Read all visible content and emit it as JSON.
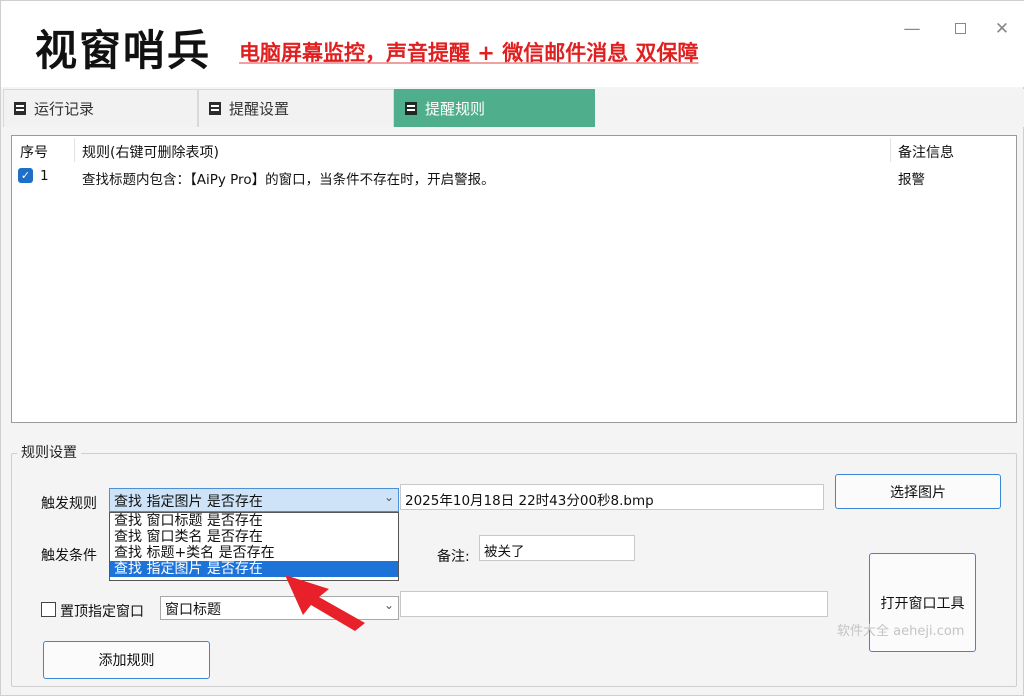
{
  "app": {
    "title": "视窗哨兵",
    "slogan": "电脑屏幕监控，声音提醒 + 微信邮件消息 双保障",
    "window_controls": {
      "minimize": "—",
      "close": "✕"
    }
  },
  "tabs": [
    {
      "label": "运行记录",
      "active": false
    },
    {
      "label": "提醒设置",
      "active": false
    },
    {
      "label": "提醒规则",
      "active": true
    }
  ],
  "rules_table": {
    "columns": [
      "序号",
      "规则(右键可删除表项)",
      "备注信息"
    ],
    "rows": [
      {
        "checked": true,
        "index": "1",
        "rule": "查找标题内包含：【AiPy Pro】的窗口，当条件不存在时，开启警报。",
        "note": "报警"
      }
    ]
  },
  "rule_settings": {
    "group_title": "规则设置",
    "trigger_rule_label": "触发规则",
    "trigger_rule_value": "查找 指定图片 是否存在",
    "trigger_rule_options": [
      "查找 窗口标题 是否存在",
      "查找 窗口类名 是否存在",
      "查找 标题+类名 是否存在",
      "查找 指定图片 是否存在"
    ],
    "selected_option_index": 3,
    "image_file": "2025年10月18日 22时43分00秒8.bmp",
    "choose_image_button": "选择图片",
    "trigger_condition_label": "触发条件",
    "note_label": "备注:",
    "note_value": "被关了",
    "pin_window_label": "置顶指定窗口",
    "pin_window_checked": false,
    "pin_window_combo": "窗口标题",
    "pin_window_text": "",
    "open_window_tool_button": "打开窗口工具",
    "add_rule_button": "添加规则"
  },
  "watermark": "软件大全 aeheji.com",
  "colors": {
    "accent": "#4fae8c",
    "slogan_red": "#e02020",
    "selection_blue": "#1e73d8",
    "arrow_red": "#e8202a"
  }
}
